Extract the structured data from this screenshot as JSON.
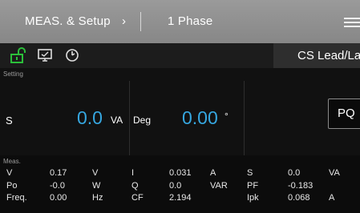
{
  "header": {
    "breadcrumb_root": "MEAS. & Setup",
    "breadcrumb_arrow": "›",
    "breadcrumb_page": "1 Phase"
  },
  "toolbar": {
    "icons": [
      "lock-open-icon",
      "screen-capture-icon",
      "clock-icon"
    ],
    "mode": "CS Lead/Lag"
  },
  "setting": {
    "section_label": "Setting",
    "s_label": "S",
    "s_value": "0.0",
    "s_unit": "VA",
    "deg_label": "Deg",
    "deg_value": "0.00",
    "deg_unit": "°",
    "pq_button": "PQ"
  },
  "meas": {
    "section_label": "Meas.",
    "rows": [
      {
        "l1": "V",
        "v1": "0.17",
        "u1": "V",
        "l2": "I",
        "v2": "0.031",
        "u2": "A",
        "l3": "S",
        "v3": "0.0",
        "u3": "VA"
      },
      {
        "l1": "Po",
        "v1": "-0.0",
        "u1": "W",
        "l2": "Q",
        "v2": "0.0",
        "u2": "VAR",
        "l3": "PF",
        "v3": "-0.183",
        "u3": ""
      },
      {
        "l1": "Freq.",
        "v1": "0.00",
        "u1": "Hz",
        "l2": "CF",
        "v2": "2.194",
        "u2": "",
        "l3": "Ipk",
        "v3": "0.068",
        "u3": "A"
      }
    ]
  },
  "colors": {
    "accent_value": "#36a7e0",
    "lock_icon": "#2bbf3a",
    "header_bg": "#8f8f8f"
  }
}
